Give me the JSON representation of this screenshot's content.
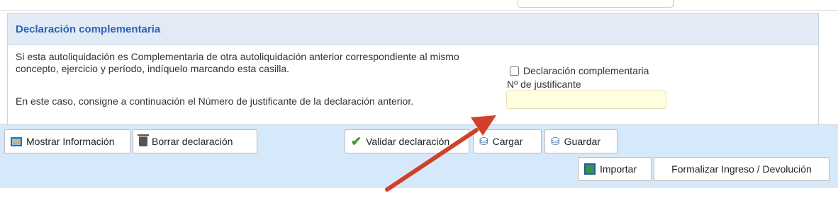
{
  "section": {
    "title": "Declaración complementaria",
    "paragraph_1": "Si esta autoliquidación es Complementaria de otra autoliquidación anterior correspondiente al mismo concepto, ejercicio y período, indíquelo marcando esta casilla.",
    "paragraph_2": "En este caso, consigne a continuación el Número de justificante de la declaración anterior.",
    "checkbox_label": "Declaración complementaria",
    "checkbox_checked": false,
    "justificante_label": "Nº de justificante",
    "justificante_value": ""
  },
  "toolbar": {
    "show_info": "Mostrar Información",
    "clear_declaration": "Borrar declaración",
    "validate_declaration": "Validar declaración",
    "load": "Cargar",
    "save": "Guardar",
    "import": "Importar",
    "formalize": "Formalizar Ingreso / Devolución"
  },
  "icons": {
    "show_info": "monitor-icon",
    "clear_declaration": "trash-icon",
    "validate_declaration": "check-icon",
    "load": "database-icon",
    "save": "database-save-icon",
    "import": "import-icon"
  },
  "colors": {
    "header_text": "#2b62b8",
    "header_bg": "#e2ebf5",
    "toolbar_bg": "#d6e9fa",
    "input_bg": "#ffffdf",
    "annotation_arrow": "#d1402a"
  }
}
